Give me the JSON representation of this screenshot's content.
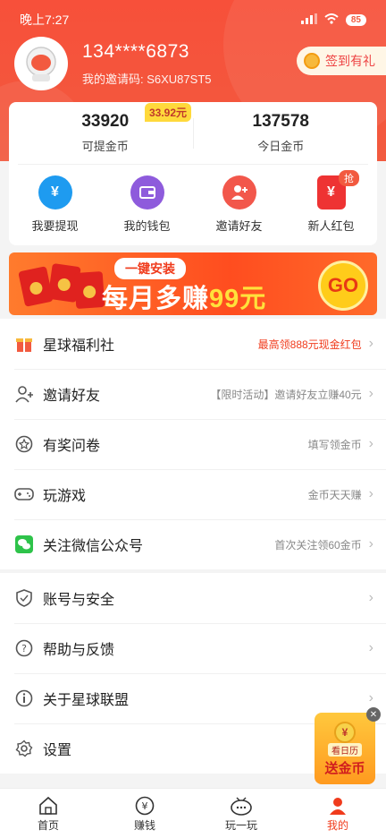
{
  "status_bar": {
    "time": "晚上7:27",
    "battery": "85"
  },
  "profile": {
    "phone": "134****6873",
    "invite_code": "我的邀请码: S6XU87ST5",
    "checkin_label": "签到有礼"
  },
  "stats": [
    {
      "value": "33920",
      "label": "可提金币",
      "tag": "33.92元"
    },
    {
      "value": "137578",
      "label": "今日金币"
    }
  ],
  "actions": [
    {
      "label": "我要提现",
      "icon": "money-bag-icon",
      "color": "#1e9bf0",
      "glyph": "¥"
    },
    {
      "label": "我的钱包",
      "icon": "wallet-icon",
      "color": "#8e5bdc",
      "glyph": "▣"
    },
    {
      "label": "邀请好友",
      "icon": "add-friend-icon",
      "color": "#f2574b",
      "glyph": "+"
    },
    {
      "label": "新人红包",
      "icon": "red-envelope-icon",
      "color": "#e33",
      "glyph": "¥",
      "tag": "抢"
    }
  ],
  "banner": {
    "pill": "一键安装",
    "main_prefix": "每月多赚",
    "main_highlight": "99元",
    "go": "GO"
  },
  "list_main": [
    {
      "title": "星球福利社",
      "hint": "最高领888元现金红包",
      "icon": "gift-icon",
      "hint_red": true
    },
    {
      "title": "邀请好友",
      "hint": "【限时活动】邀请好友立赚40元",
      "icon": "user-add-icon"
    },
    {
      "title": "有奖问卷",
      "hint": "填写领金币",
      "icon": "star-badge-icon"
    },
    {
      "title": "玩游戏",
      "hint": "金币天天赚",
      "icon": "gamepad-icon"
    },
    {
      "title": "关注微信公众号",
      "hint": "首次关注领60金币",
      "icon": "wechat-icon"
    }
  ],
  "list_settings": [
    {
      "title": "账号与安全",
      "icon": "shield-icon"
    },
    {
      "title": "帮助与反馈",
      "icon": "question-icon"
    },
    {
      "title": "关于星球联盟",
      "icon": "info-icon"
    },
    {
      "title": "设置",
      "icon": "gear-icon"
    }
  ],
  "floater": {
    "line1": "看日历",
    "line2": "送金币",
    "cap": "¥"
  },
  "tabs": [
    {
      "label": "首页",
      "icon": "home-icon"
    },
    {
      "label": "赚钱",
      "icon": "yen-coin-icon"
    },
    {
      "label": "玩一玩",
      "icon": "controller-icon"
    },
    {
      "label": "我的",
      "icon": "profile-icon",
      "active": true
    }
  ],
  "colors": {
    "primary": "#f25a3f",
    "accent_yellow": "#ffd93b",
    "red_text": "#f03b1c"
  }
}
